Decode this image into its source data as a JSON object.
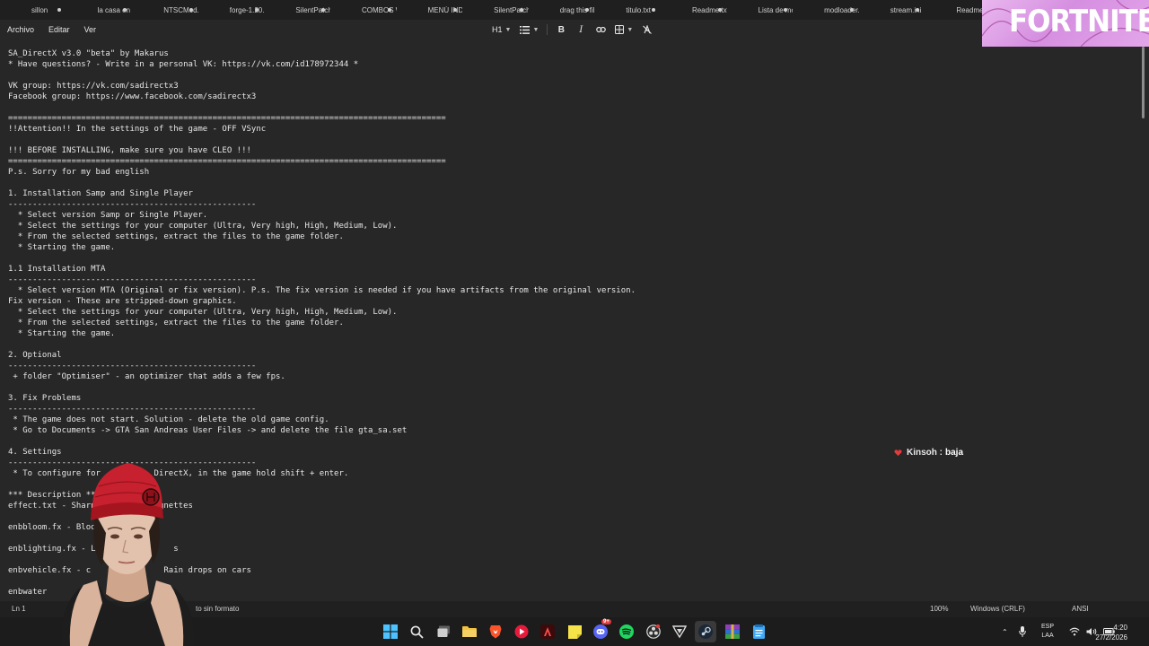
{
  "tabs": [
    {
      "label": "sillon"
    },
    {
      "label": "la casa en to"
    },
    {
      "label": "NTSCMod.otr"
    },
    {
      "label": "forge-1.20.1-47.4.2"
    },
    {
      "label": "SilentPatchE"
    },
    {
      "label": "COMBOS W"
    },
    {
      "label": "MENÚ INDIV"
    },
    {
      "label": "SilentPatchSA.ini"
    },
    {
      "label": "drag this file in yo"
    },
    {
      "label": "titulo.txt"
    },
    {
      "label": "Readme.txt"
    },
    {
      "label": "Lista de mods y cc"
    },
    {
      "label": "modloader.ini"
    },
    {
      "label": "stream.ini"
    },
    {
      "label": "Readme"
    }
  ],
  "menu": {
    "file": "Archivo",
    "edit": "Editar",
    "view": "Ver"
  },
  "toolbar": {
    "heading": "H1"
  },
  "document": {
    "lines": [
      "SA_DirectX v3.0 \"beta\" by Makarus",
      "* Have questions? - Write in a personal VK: https://vk.com/id178972344 *",
      "",
      "VK group: https://vk.com/sadirectx3",
      "Facebook group: https://www.facebook.com/sadirectx3",
      "",
      "==========================================================================================",
      "!!Attention!! In the settings of the game - OFF VSync",
      "",
      "!!! BEFORE INSTALLING, make sure you have CLEO !!!",
      "==========================================================================================",
      "P.s. Sorry for my bad english",
      "",
      "1. Installation Samp and Single Player",
      "---------------------------------------------------",
      "  * Select version Samp or Single Player.",
      "  * Select the settings for your computer (Ultra, Very high, High, Medium, Low).",
      "  * From the selected settings, extract the files to the game folder.",
      "  * Starting the game.",
      "",
      "1.1 Installation MTA",
      "---------------------------------------------------",
      "  * Select version MTA (Original or fix version). P.s. The fix version is needed if you have artifacts from the original version.",
      "Fix version - These are stripped-down graphics.",
      "  * Select the settings for your computer (Ultra, Very high, High, Medium, Low).",
      "  * From the selected settings, extract the files to the game folder.",
      "  * Starting the game.",
      "",
      "2. Optional",
      "---------------------------------------------------",
      " + folder \"Optimiser\" - an optimizer that adds a few fps.",
      "",
      "3. Fix Problems",
      "---------------------------------------------------",
      " * The game does not start. Solution - delete the old game config.",
      " * Go to Documents -> GTA San Andreas User Files -> and delete the file gta_sa.set",
      "",
      "4. Settings",
      "---------------------------------------------------",
      " * To configure for           DirectX, in the game hold shift + enter.",
      "",
      "*** Description **",
      "effect.txt - Sharp             gnettes",
      "",
      "enbbloom.fx - Bloo",
      "",
      "enblighting.fx - Li               s",
      "",
      "enbvehicle.fx - c               Rain drops on cars",
      "",
      "enbwater"
    ]
  },
  "status": {
    "position": "Ln 1",
    "format": "to sin formato",
    "zoom": "100%",
    "line_ending": "Windows (CRLF)",
    "encoding": "ANSI"
  },
  "overlay": {
    "brand": "FORTNITE",
    "chat_user": "Kinsoh :",
    "chat_message": "baja"
  },
  "taskbar": {
    "lang_line1": "ESP",
    "lang_line2": "LAA",
    "time": "4:20",
    "date": "27/2/2026",
    "discord_badge": "9+"
  }
}
